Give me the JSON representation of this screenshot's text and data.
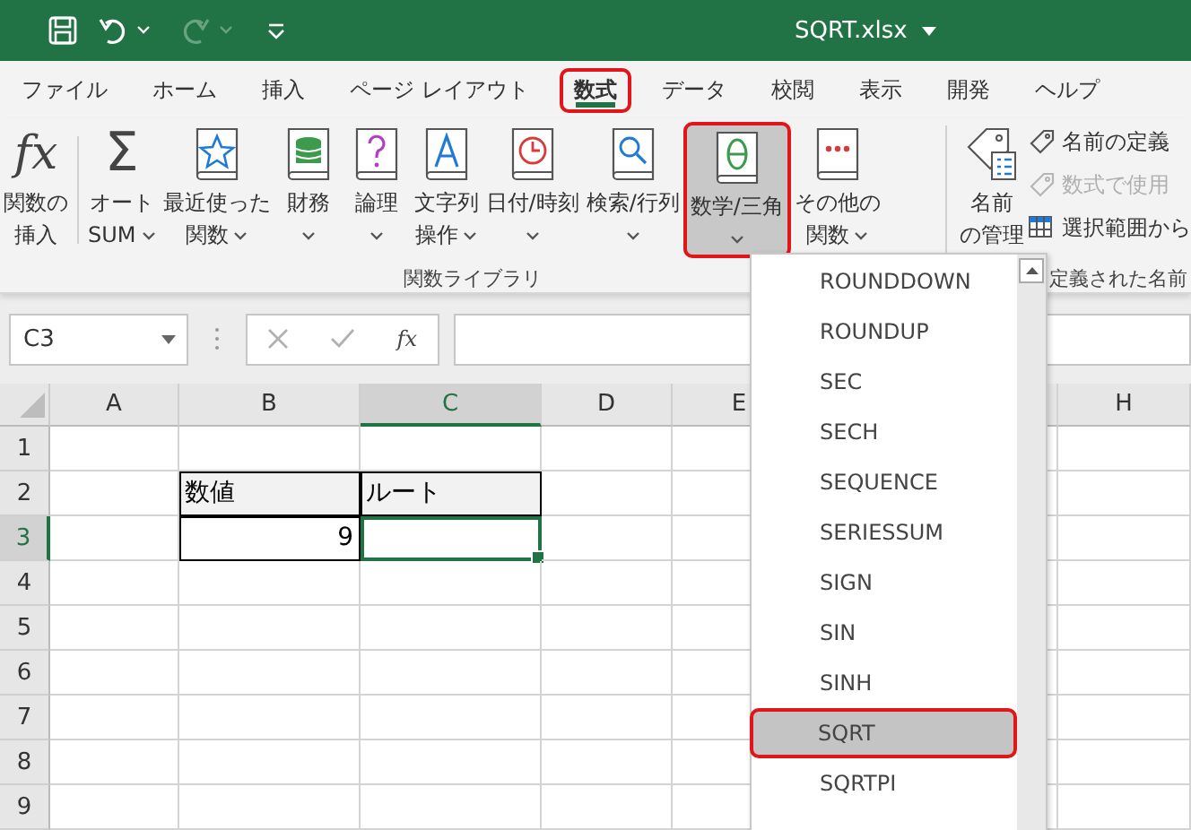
{
  "title_bar": {
    "file_name": "SQRT.xlsx"
  },
  "menu_tabs": [
    {
      "label": "ファイル",
      "selected": false,
      "highlighted": false
    },
    {
      "label": "ホーム",
      "selected": false,
      "highlighted": false
    },
    {
      "label": "挿入",
      "selected": false,
      "highlighted": false
    },
    {
      "label": "ページ レイアウト",
      "selected": false,
      "highlighted": false
    },
    {
      "label": "数式",
      "selected": true,
      "highlighted": true
    },
    {
      "label": "データ",
      "selected": false,
      "highlighted": false
    },
    {
      "label": "校閲",
      "selected": false,
      "highlighted": false
    },
    {
      "label": "表示",
      "selected": false,
      "highlighted": false
    },
    {
      "label": "開発",
      "selected": false,
      "highlighted": false
    },
    {
      "label": "ヘルプ",
      "selected": false,
      "highlighted": false
    }
  ],
  "ribbon": {
    "function_library": {
      "label": "関数ライブラリ",
      "buttons": [
        {
          "kind": "glyph",
          "glyph": "fx",
          "lines": [
            "関数の",
            "挿入"
          ],
          "has_menu": false,
          "selected": false,
          "highlighted": false
        },
        {
          "kind": "glyph",
          "glyph": "Σ",
          "lines": [
            "オート",
            "SUM"
          ],
          "has_menu": true,
          "selected": false,
          "highlighted": false
        },
        {
          "kind": "star",
          "lines": [
            "最近使った",
            "関数"
          ],
          "has_menu": true,
          "selected": false,
          "highlighted": false
        },
        {
          "kind": "database",
          "lines": [
            "財務"
          ],
          "has_menu": true,
          "selected": false,
          "highlighted": false
        },
        {
          "kind": "question",
          "lines": [
            "論理"
          ],
          "has_menu": true,
          "selected": false,
          "highlighted": false
        },
        {
          "kind": "letter",
          "lines": [
            "文字列",
            "操作"
          ],
          "has_menu": true,
          "selected": false,
          "highlighted": false
        },
        {
          "kind": "clock",
          "lines": [
            "日付/時刻"
          ],
          "has_menu": true,
          "selected": false,
          "highlighted": false
        },
        {
          "kind": "search",
          "lines": [
            "検索/行列"
          ],
          "has_menu": true,
          "selected": false,
          "highlighted": false
        },
        {
          "kind": "theta",
          "lines": [
            "数学/三角"
          ],
          "has_menu": true,
          "selected": true,
          "highlighted": true
        },
        {
          "kind": "dots",
          "lines": [
            "その他の",
            "関数"
          ],
          "has_menu": true,
          "selected": false,
          "highlighted": false
        }
      ]
    },
    "defined_names": {
      "label": "定義された名前",
      "manager": {
        "lines": [
          "名前",
          "の管理"
        ]
      },
      "small_buttons": [
        {
          "kind": "tag",
          "label": "名前の定義",
          "disabled": false
        },
        {
          "kind": "tag",
          "label": "数式で使用",
          "disabled": true
        },
        {
          "kind": "grid",
          "label": "選択範囲から",
          "disabled": false
        }
      ]
    }
  },
  "formula_bar": {
    "name_box": "C3",
    "fx": "fx"
  },
  "sheet": {
    "columns": [
      {
        "label": "A",
        "selected": false
      },
      {
        "label": "B",
        "selected": false
      },
      {
        "label": "C",
        "selected": true
      },
      {
        "label": "D",
        "selected": false
      },
      {
        "label": "E",
        "selected": false
      },
      {
        "label": "H",
        "selected": false,
        "after_gap": true
      }
    ],
    "rows": [
      {
        "label": "1",
        "selected": false
      },
      {
        "label": "2",
        "selected": false,
        "cells": [
          {
            "kind": "empty"
          },
          {
            "kind": "label",
            "text": "数値"
          },
          {
            "kind": "label",
            "text": "ルート"
          }
        ]
      },
      {
        "label": "3",
        "selected": true,
        "cells": [
          {
            "kind": "empty"
          },
          {
            "kind": "number",
            "text": "9"
          },
          {
            "kind": "active"
          }
        ]
      },
      {
        "label": "4",
        "selected": false
      },
      {
        "label": "5",
        "selected": false
      },
      {
        "label": "6",
        "selected": false
      },
      {
        "label": "7",
        "selected": false
      },
      {
        "label": "8",
        "selected": false
      },
      {
        "label": "9",
        "selected": false
      }
    ]
  },
  "dropdown": {
    "items": [
      {
        "label": "ROUNDDOWN",
        "selected": false
      },
      {
        "label": "ROUNDUP",
        "selected": false
      },
      {
        "label": "SEC",
        "selected": false
      },
      {
        "label": "SECH",
        "selected": false
      },
      {
        "label": "SEQUENCE",
        "selected": false
      },
      {
        "label": "SERIESSUM",
        "selected": false
      },
      {
        "label": "SIGN",
        "selected": false
      },
      {
        "label": "SIN",
        "selected": false
      },
      {
        "label": "SINH",
        "selected": false
      },
      {
        "label": "SQRT",
        "selected": true
      },
      {
        "label": "SQRTPI",
        "selected": false
      }
    ]
  }
}
